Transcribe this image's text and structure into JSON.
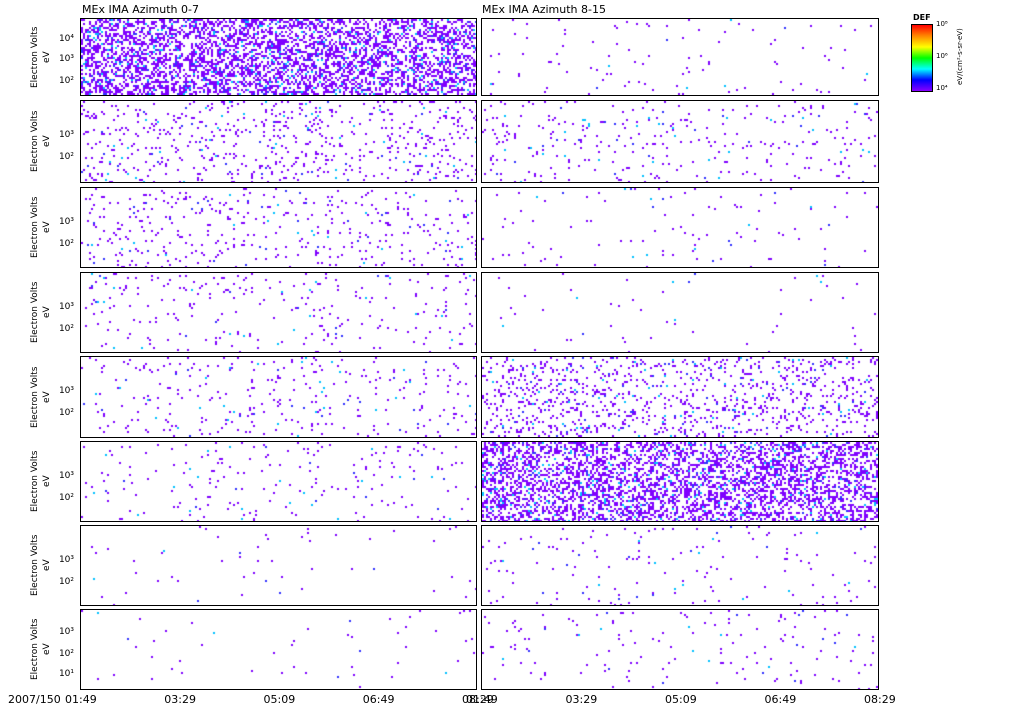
{
  "chart_data": {
    "type": "heatmap",
    "titles": [
      "MEx IMA Azimuth 0-7",
      "MEx IMA Azimuth 8-15"
    ],
    "ylabel": "Electron Volts",
    "yunit": "eV",
    "panel_rows": 8,
    "yticks": [
      [
        "10⁴",
        "10³",
        "10²"
      ],
      [
        "10³",
        "10²"
      ],
      [
        "10³",
        "10²"
      ],
      [
        "10³",
        "10²"
      ],
      [
        "10³",
        "10²"
      ],
      [
        "10³",
        "10²"
      ],
      [
        "10³",
        "10²"
      ],
      [
        "10³",
        "10²",
        "10¹"
      ]
    ],
    "xlabel_prefix": "2007/150",
    "xticks": [
      "01:49",
      "03:29",
      "05:09",
      "06:49",
      "08:29"
    ],
    "colorbar": {
      "label": "DEF",
      "ticks": [
        "10⁸",
        "10⁶",
        "10⁴"
      ],
      "unit": "eV/(cm²-s-sr-eV)"
    },
    "density_left": [
      0.9,
      0.12,
      0.08,
      0.05,
      0.06,
      0.04,
      0.01,
      0.01
    ],
    "density_right": [
      0.02,
      0.06,
      0.02,
      0.01,
      0.2,
      0.8,
      0.03,
      0.03
    ]
  }
}
